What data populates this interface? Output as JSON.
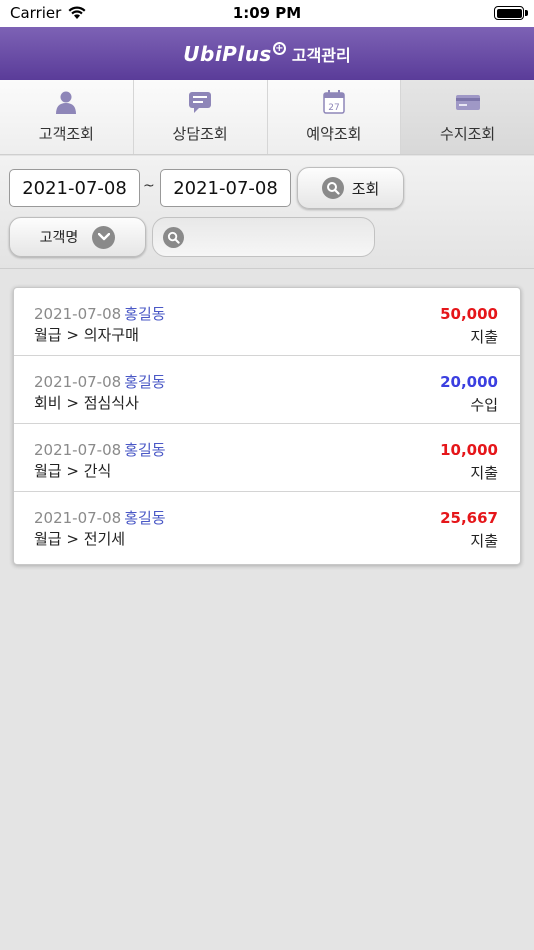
{
  "status": {
    "carrier": "Carrier",
    "time": "1:09 PM"
  },
  "header": {
    "logo": "UbiPlus",
    "logo_plus": "+",
    "title": "고객관리"
  },
  "tabs": [
    {
      "label": "고객조회",
      "icon": "person-icon"
    },
    {
      "label": "상담조회",
      "icon": "chat-bubble-icon"
    },
    {
      "label": "예약조회",
      "icon": "calendar-icon",
      "icon_text": "27"
    },
    {
      "label": "수지조회",
      "icon": "card-icon"
    }
  ],
  "filter": {
    "start_date": "2021-07-08",
    "end_date": "2021-07-08",
    "separator": "~",
    "search_label": "조회",
    "field_select": "고객명",
    "search_value": ""
  },
  "colors": {
    "expense": "#e5161a",
    "income": "#3b3fe0",
    "header": "#5f46a3"
  },
  "records": [
    {
      "date": "2021-07-08",
      "name": "홍길동",
      "category": "월급 > 의자구매",
      "amount": "50,000",
      "type": "지출",
      "kind": "expense"
    },
    {
      "date": "2021-07-08",
      "name": "홍길동",
      "category": "회비 > 점심식사",
      "amount": "20,000",
      "type": "수입",
      "kind": "income"
    },
    {
      "date": "2021-07-08",
      "name": "홍길동",
      "category": "월급 > 간식",
      "amount": "10,000",
      "type": "지출",
      "kind": "expense"
    },
    {
      "date": "2021-07-08",
      "name": "홍길동",
      "category": "월급 > 전기세",
      "amount": "25,667",
      "type": "지출",
      "kind": "expense"
    }
  ]
}
